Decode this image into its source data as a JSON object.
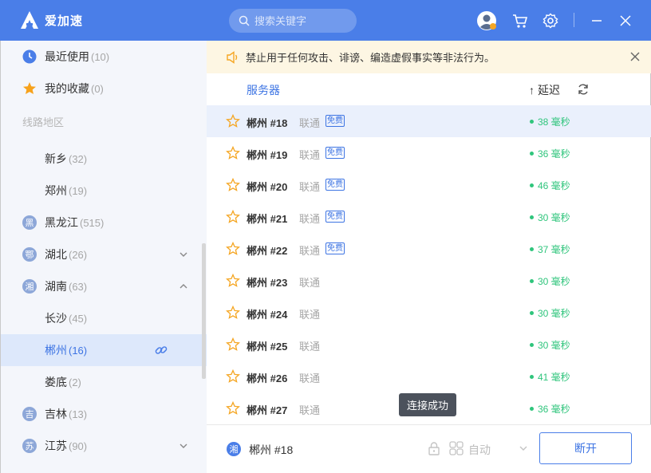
{
  "app": {
    "name": "爱加速"
  },
  "search": {
    "placeholder": "搜索关键字"
  },
  "sidebar": {
    "recent": {
      "label": "最近使用",
      "count": "(10)"
    },
    "favorites": {
      "label": "我的收藏",
      "count": "(0)"
    },
    "section_title": "线路地区",
    "regions": [
      {
        "badge": "",
        "label": "新乡",
        "count": "(32)"
      },
      {
        "badge": "",
        "label": "郑州",
        "count": "(19)"
      },
      {
        "badge": "黑",
        "label": "黑龙江",
        "count": "(515)"
      },
      {
        "badge": "鄂",
        "label": "湖北",
        "count": "(26)"
      },
      {
        "badge": "湘",
        "label": "湖南",
        "count": "(63)"
      },
      {
        "badge": "",
        "label": "长沙",
        "count": "(45)"
      },
      {
        "badge": "",
        "label": "郴州",
        "count": "(16)"
      },
      {
        "badge": "",
        "label": "娄底",
        "count": "(2)"
      },
      {
        "badge": "吉",
        "label": "吉林",
        "count": "(13)"
      },
      {
        "badge": "苏",
        "label": "江苏",
        "count": "(90)"
      }
    ]
  },
  "notice": {
    "text": "禁止用于任何攻击、诽谤、编造虚假事实等非法行为。"
  },
  "list": {
    "col_server": "服务器",
    "col_delay": "延迟",
    "sort_arrow": "↑",
    "rows": [
      {
        "name": "郴州 #18",
        "isp": "联通",
        "tag": "免费",
        "delay": "38 毫秒"
      },
      {
        "name": "郴州 #19",
        "isp": "联通",
        "tag": "免费",
        "delay": "36 毫秒"
      },
      {
        "name": "郴州 #20",
        "isp": "联通",
        "tag": "免费",
        "delay": "46 毫秒"
      },
      {
        "name": "郴州 #21",
        "isp": "联通",
        "tag": "免费",
        "delay": "30 毫秒"
      },
      {
        "name": "郴州 #22",
        "isp": "联通",
        "tag": "免费",
        "delay": "37 毫秒"
      },
      {
        "name": "郴州 #23",
        "isp": "联通",
        "tag": "",
        "delay": "30 毫秒"
      },
      {
        "name": "郴州 #24",
        "isp": "联通",
        "tag": "",
        "delay": "30 毫秒"
      },
      {
        "name": "郴州 #25",
        "isp": "联通",
        "tag": "",
        "delay": "30 毫秒"
      },
      {
        "name": "郴州 #26",
        "isp": "联通",
        "tag": "",
        "delay": "41 毫秒"
      },
      {
        "name": "郴州 #27",
        "isp": "联通",
        "tag": "",
        "delay": "36 毫秒"
      }
    ]
  },
  "bottom": {
    "current_badge": "湘",
    "current_name": "郴州 #18",
    "mode_label": "自动",
    "disconnect_label": "断开"
  },
  "toast": {
    "text": "连接成功"
  },
  "colors": {
    "brand": "#4a7ee8",
    "good_latency": "#2fc57c",
    "selected_bg": "#dde8fb"
  }
}
